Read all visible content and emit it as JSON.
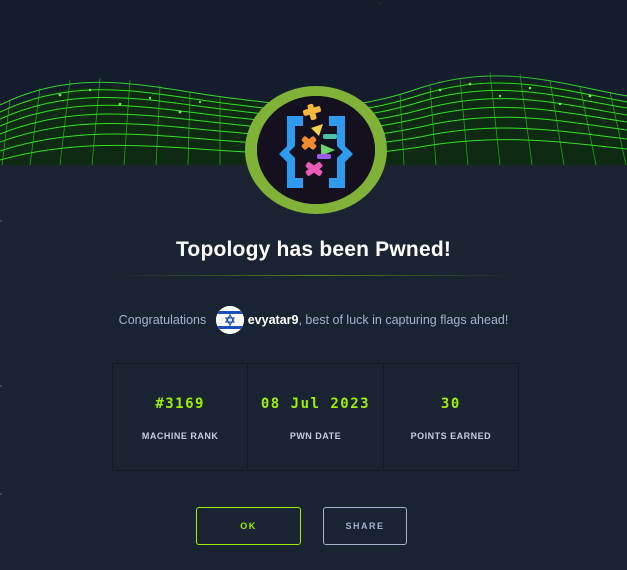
{
  "modal": {
    "title": "Topology has been Pwned!",
    "congrats": {
      "prefix": "Congratulations",
      "username": "evyatar9",
      "suffix": ", best of luck in capturing flags ahead!",
      "flag_icon": "israel-flag-icon"
    },
    "stats": [
      {
        "value": "#3169",
        "label": "MACHINE RANK"
      },
      {
        "value": "08 Jul 2023",
        "label": "PWN DATE"
      },
      {
        "value": "30",
        "label": "POINTS EARNED"
      }
    ],
    "buttons": {
      "ok_label": "OK",
      "share_label": "SHARE"
    }
  },
  "colors": {
    "accent": "#9fef00",
    "background": "#1a2332",
    "ring": "#7fb236",
    "muted_text": "#a4b1cd"
  },
  "icons": {
    "machine_avatar": "topology-machine-icon",
    "banner": "green-wave-grid-banner"
  }
}
